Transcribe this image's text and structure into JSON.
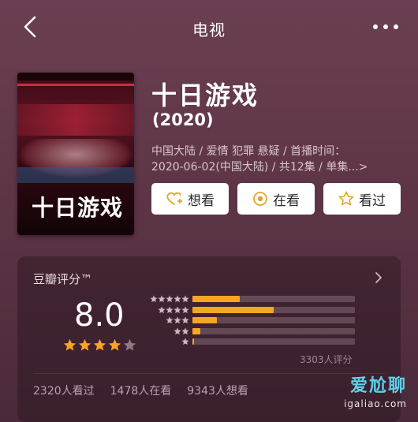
{
  "nav": {
    "title": "电视"
  },
  "show": {
    "title": "十日游戏",
    "year": "(2020)",
    "meta_line1": "中国大陆 / 爱情 犯罪 悬疑 / 首播时间：",
    "meta_line2": "2020-06-02(中国大陆) / 共12集 / 单集...>",
    "poster_text": "十日游戏"
  },
  "actions": [
    {
      "label": "想看",
      "icon": "heart-plus-icon"
    },
    {
      "label": "在看",
      "icon": "target-icon"
    },
    {
      "label": "看过",
      "icon": "star-outline-icon"
    }
  ],
  "rating": {
    "title": "豆瓣评分™",
    "score": "8.0",
    "stars_filled": 4,
    "stars_total": 5,
    "count_label": "3303人评分",
    "distribution": [
      {
        "stars": 5,
        "fraction": 0.29
      },
      {
        "stars": 4,
        "fraction": 0.5
      },
      {
        "stars": 3,
        "fraction": 0.15
      },
      {
        "stars": 2,
        "fraction": 0.05
      },
      {
        "stars": 1,
        "fraction": 0.01
      }
    ],
    "accent_color": "#f5a623"
  },
  "stats": {
    "watched": "2320人看过",
    "watching": "1478人在看",
    "want": "9343人想看"
  },
  "watermark": {
    "text": "爱尬聊",
    "url": "igaliao.com"
  }
}
